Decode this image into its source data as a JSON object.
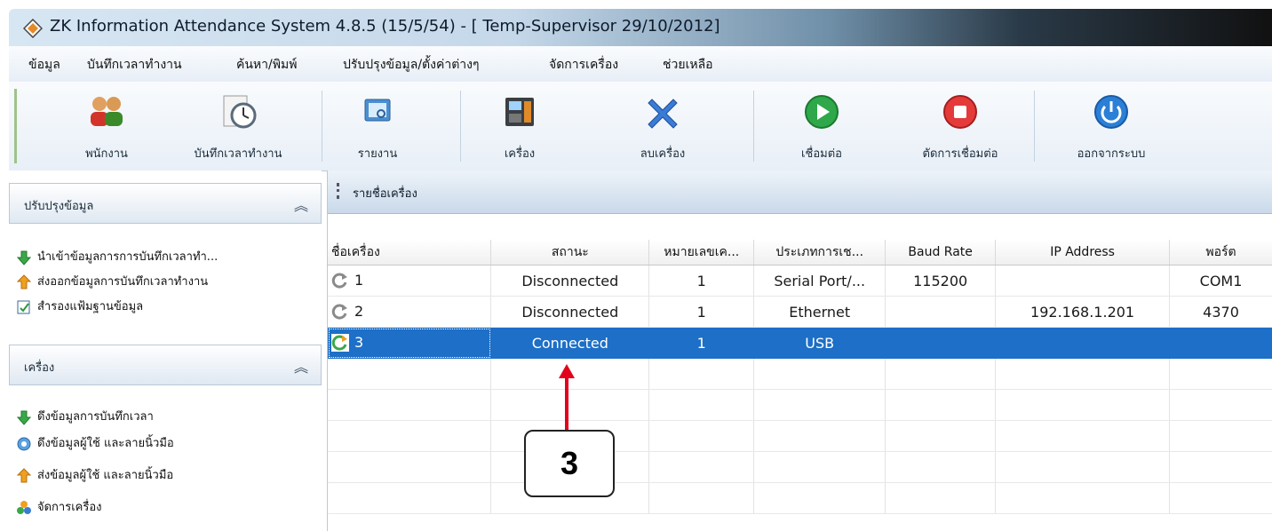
{
  "window": {
    "title": "ZK Information Attendance System 4.8.5 (15/5/54) - [ Temp-Supervisor 29/10/2012]"
  },
  "menu": [
    "ข้อมูล",
    "บันทึกเวลาทำงาน",
    "ค้นหา/พิมพ์",
    "ปรับปรุงข้อมูล/ตั้งค่าต่างๆ",
    "จัดการเครื่อง",
    "ช่วยเหลือ"
  ],
  "toolbar": {
    "employee": "พนักงาน",
    "attendance": "บันทึกเวลาทำงาน",
    "report": "รายงาน",
    "device": "เครื่อง",
    "delete_device": "ลบเครื่อง",
    "connect": "เชื่อมต่อ",
    "disconnect": "ตัดการเชื่อมต่อ",
    "logout": "ออกจากระบบ"
  },
  "sidebar": {
    "panel1": {
      "title": "ปรับปรุงข้อมูล",
      "items": [
        "นำเข้าข้อมูลการการบันทึกเวลาทำ...",
        "ส่งออกข้อมูลการบันทึกเวลาทำงาน",
        "สำรองแฟ้มฐานข้อมูล"
      ]
    },
    "panel2": {
      "title": "เครื่อง",
      "items": [
        "ดึงข้อมูลการบันทึกเวลา",
        "ดึงข้อมูลผู้ใช้ และลายนิ้วมือ",
        "ส่งข้อมูลผู้ใช้ และลายนิ้วมือ",
        "จัดการเครื่อง"
      ]
    }
  },
  "main": {
    "header": "รายชื่อเครื่อง",
    "columns": [
      "ชื่อเครื่อง",
      "สถานะ",
      "หมายเลขเค...",
      "ประเภทการเช...",
      "Baud Rate",
      "IP Address",
      "พอร์ต"
    ],
    "rows": [
      [
        "1",
        "Disconnected",
        "1",
        "Serial Port/...",
        "115200",
        "",
        "COM1"
      ],
      [
        "2",
        "Disconnected",
        "1",
        "Ethernet",
        "",
        "192.168.1.201",
        "4370"
      ],
      [
        "3",
        "Connected",
        "1",
        "USB",
        "",
        "",
        ""
      ]
    ]
  },
  "callout": {
    "label": "3"
  },
  "colors": {
    "selection": "#1d6fc7",
    "arrow": "#e3001b"
  }
}
